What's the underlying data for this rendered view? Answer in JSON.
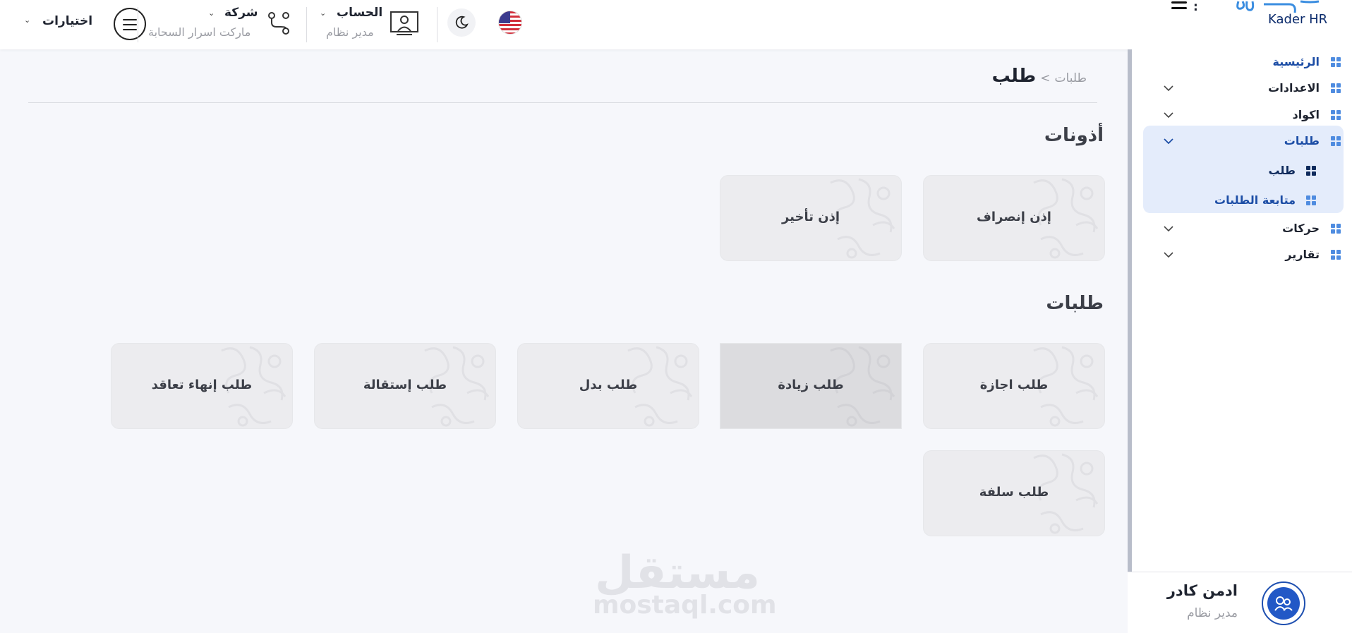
{
  "header": {
    "options_label": "اختيارات",
    "company": {
      "title": "شركة",
      "subtitle": "ماركت اسرار السحابة"
    },
    "account": {
      "title": "الحساب",
      "subtitle": "مدير نظام"
    },
    "theme_icon": "moon-icon",
    "language_icon": "us-flag-icon",
    "menu_colon": ":",
    "logo_text": "Kader HR"
  },
  "sidebar": {
    "items": [
      {
        "label": "الرئيسية",
        "icon": "grid-icon",
        "expandable": false
      },
      {
        "label": "الاعدادات",
        "icon": "grid-icon",
        "expandable": true
      },
      {
        "label": "اكواد",
        "icon": "grid-icon",
        "expandable": true
      },
      {
        "label": "طلبات",
        "icon": "grid-icon",
        "expandable": true,
        "expanded": true,
        "children": [
          {
            "label": "طلب",
            "current": true
          },
          {
            "label": "متابعة الطلبات"
          }
        ]
      },
      {
        "label": "حركات",
        "icon": "grid-icon",
        "expandable": true
      },
      {
        "label": "تقارير",
        "icon": "grid-icon",
        "expandable": true
      }
    ],
    "user": {
      "name": "ادمن كادر",
      "role": "مدير نظام"
    }
  },
  "breadcrumb": {
    "parent": "طلبات",
    "separator": ">",
    "current": "طلب"
  },
  "sections": {
    "permissions": {
      "title": "أذونات",
      "cards": [
        "إذن إنصراف",
        "إذن تأخير"
      ]
    },
    "requests": {
      "title": "طلبات",
      "cards": [
        "طلب اجازة",
        "طلب زيادة",
        "طلب بدل",
        "طلب إستقالة",
        "طلب إنهاء تعاقد",
        "طلب سلفة"
      ]
    }
  },
  "watermark": {
    "arabic": "مستقل",
    "latin": "mostaql.com"
  },
  "colors": {
    "accent": "#1d4ea6",
    "icon_blue": "#4f8ce0",
    "active_bg": "#e4ecfb",
    "card_bg": "#ececef"
  }
}
